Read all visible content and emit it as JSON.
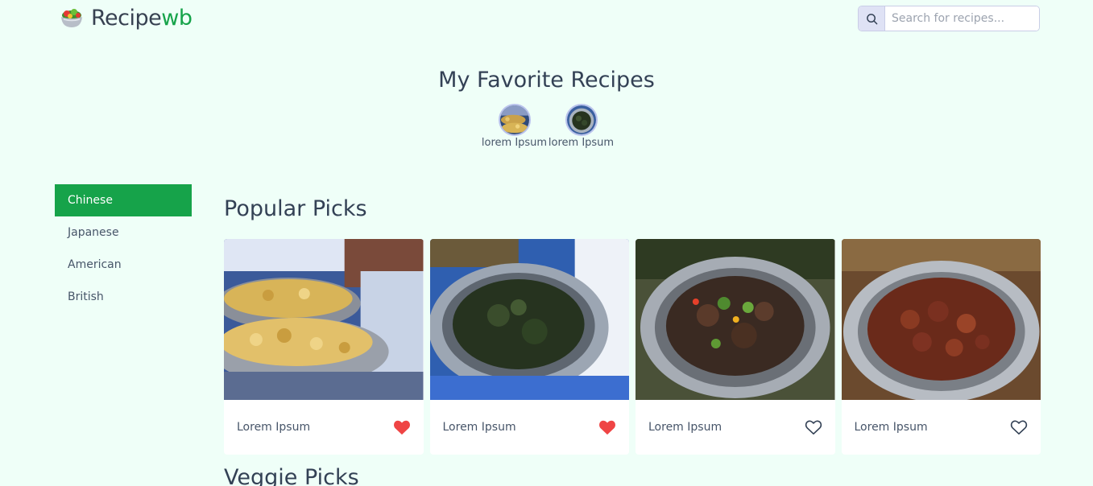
{
  "header": {
    "logo_main": "Recipe",
    "logo_accent": "wb",
    "logo_icon": "salad-bowl-icon",
    "search": {
      "placeholder": "Search for recipes...",
      "icon": "search-icon"
    }
  },
  "favorites": {
    "title": "My Favorite Recipes",
    "items": [
      {
        "label": "lorem Ipsum",
        "image": "potato-dish-thumbnail"
      },
      {
        "label": "lorem Ipsum",
        "image": "greens-dish-thumbnail"
      }
    ]
  },
  "sidebar": {
    "items": [
      {
        "label": "Chinese",
        "active": true
      },
      {
        "label": "Japanese",
        "active": false
      },
      {
        "label": "American",
        "active": false
      },
      {
        "label": "British",
        "active": false
      }
    ]
  },
  "sections": {
    "popular": {
      "title": "Popular Picks",
      "cards": [
        {
          "name": "Lorem Ipsum",
          "favorited": true,
          "image": "roasted-potatoes-photo"
        },
        {
          "name": "Lorem Ipsum",
          "favorited": true,
          "image": "sauteed-greens-photo"
        },
        {
          "name": "Lorem Ipsum",
          "favorited": false,
          "image": "grilled-meat-photo"
        },
        {
          "name": "Lorem Ipsum",
          "favorited": false,
          "image": "sausage-chunks-photo"
        }
      ]
    },
    "veggie": {
      "title": "Veggie Picks"
    }
  },
  "colors": {
    "background": "#effff8",
    "accent": "#16a34a",
    "heart_filled": "#ef4444",
    "text": "#334155"
  }
}
